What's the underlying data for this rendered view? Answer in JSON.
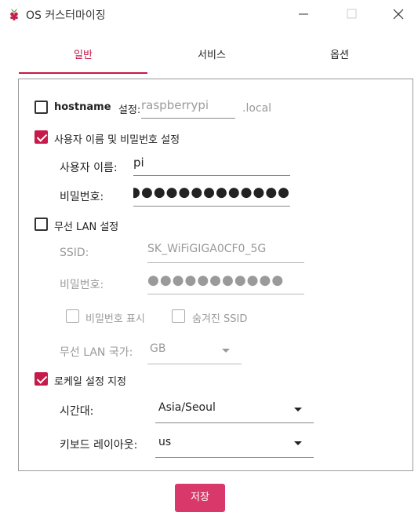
{
  "window": {
    "title": "OS 커스터마이징"
  },
  "tabs": [
    {
      "label": "일반"
    },
    {
      "label": "서비스"
    },
    {
      "label": "옵션"
    }
  ],
  "general": {
    "hostname": {
      "label": "hostname 설정:",
      "label_en": "hostname",
      "label_ko": "설정:",
      "checked": false,
      "value": "raspberrypi",
      "suffix": ".local"
    },
    "user": {
      "label": "사용자 이름 및 비밀번호 설정",
      "checked": true,
      "username_label": "사용자 이름:",
      "username_value": "pi",
      "password_label": "비밀번호:",
      "password_value": "●●●●●●●●●●●●●●●"
    },
    "wifi": {
      "label": "무선 LAN 설정",
      "checked": false,
      "ssid_label": "SSID:",
      "ssid_value": "SK_WiFiGIGA0CF0_5G",
      "password_label": "비밀번호:",
      "password_value": "●●●●●●●●●●●",
      "show_password_label": "비밀번호 표시",
      "hidden_ssid_label": "숨겨진 SSID",
      "country_label": "무선 LAN 국가:",
      "country_value": "GB"
    },
    "locale": {
      "label": "로케일 설정 지정",
      "checked": true,
      "timezone_label": "시간대:",
      "timezone_value": "Asia/Seoul",
      "keyboard_label": "키보드 레이아웃:",
      "keyboard_value": "us"
    }
  },
  "footer": {
    "save_label": "저장"
  },
  "colors": {
    "accent": "#c51a4a",
    "button": "#d8386a",
    "disabled_text": "#9a9a9a"
  }
}
